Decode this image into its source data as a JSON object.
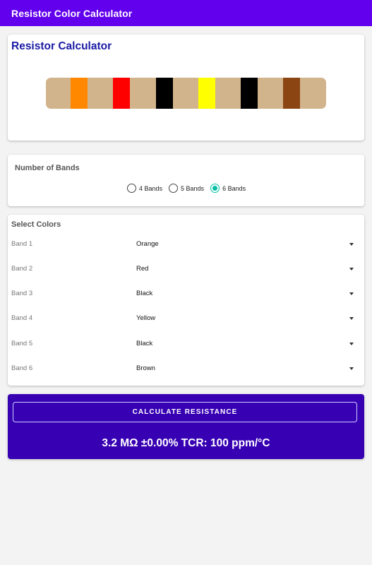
{
  "appbar": {
    "title": "Resistor Color Calculator"
  },
  "resistor_card": {
    "title": "Resistor Calculator",
    "band_colors": [
      "#ff8800",
      "#ff0000",
      "#000000",
      "#ffff00",
      "#000000",
      "#8b4513"
    ],
    "body_color": "#d2b48c"
  },
  "bands_card": {
    "label": "Number of Bands",
    "options": [
      {
        "label": "4 Bands",
        "checked": false
      },
      {
        "label": "5 Bands",
        "checked": false
      },
      {
        "label": "6 Bands",
        "checked": true
      }
    ]
  },
  "colors_card": {
    "label": "Select Colors",
    "rows": [
      {
        "name": "Band 1",
        "value": "Orange"
      },
      {
        "name": "Band 2",
        "value": "Red"
      },
      {
        "name": "Band 3",
        "value": "Black"
      },
      {
        "name": "Band 4",
        "value": "Yellow"
      },
      {
        "name": "Band 5",
        "value": "Black"
      },
      {
        "name": "Band 6",
        "value": "Brown"
      }
    ]
  },
  "result_card": {
    "button_label": "CALCULATE RESISTANCE",
    "result": "3.2 MΩ ±0.00% TCR: 100 ppm/°C"
  },
  "colors": {
    "appbar": "#6200ee",
    "result_bg": "#3700b3",
    "radio_accent": "#03bfa5",
    "title_blue": "#1a1aa6"
  }
}
